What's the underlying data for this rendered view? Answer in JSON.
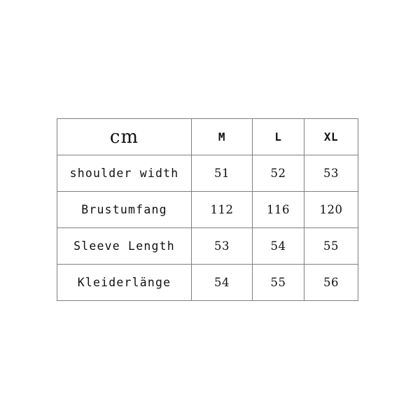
{
  "chart": {
    "unit_header": "cm",
    "size_columns": [
      "M",
      "L",
      "XL"
    ],
    "rows": [
      {
        "label": "shoulder width",
        "values": [
          "51",
          "52",
          "53"
        ]
      },
      {
        "label": "Brustumfang",
        "values": [
          "112",
          "116",
          "120"
        ]
      },
      {
        "label": "Sleeve Length",
        "values": [
          "53",
          "54",
          "55"
        ]
      },
      {
        "label": "Kleiderlänge",
        "values": [
          "54",
          "55",
          "56"
        ]
      }
    ]
  },
  "colors": {
    "background": "#ffffff",
    "border": "#7f7f7f",
    "text": "#111111"
  }
}
